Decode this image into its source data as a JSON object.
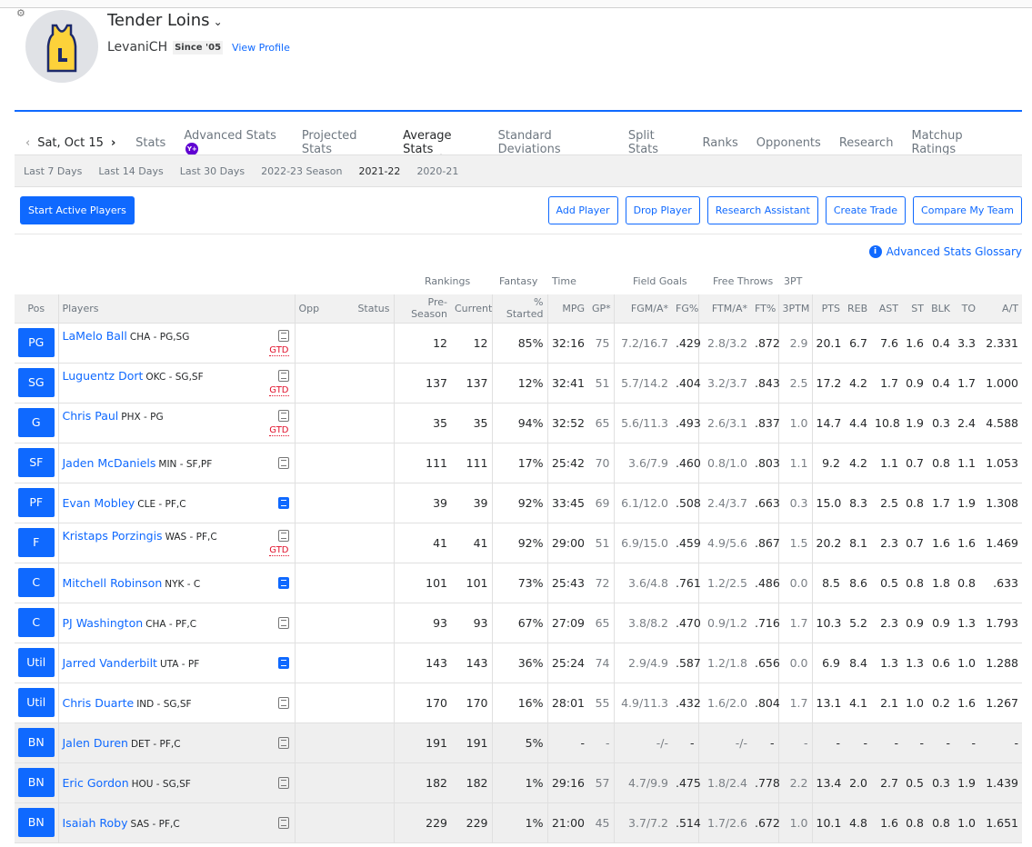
{
  "header": {
    "team_name": "Tender Loins",
    "manager": "LevaniCH",
    "since": "Since '05",
    "view_profile": "View Profile"
  },
  "nav": {
    "date": "Sat, Oct 15",
    "tabs": [
      "Stats",
      "Advanced Stats",
      "Projected Stats",
      "Average Stats",
      "Standard Deviations",
      "Split Stats",
      "Ranks",
      "Opponents",
      "Research",
      "Matchup Ratings"
    ],
    "active_tab": "Average Stats",
    "plus_badge": "Y+"
  },
  "subnav": {
    "items": [
      "Last 7 Days",
      "Last 14 Days",
      "Last 30 Days",
      "2022-23 Season",
      "2021-22",
      "2020-21"
    ],
    "active": "2021-22"
  },
  "actions": {
    "start_active": "Start Active Players",
    "add_player": "Add Player",
    "drop_player": "Drop Player",
    "research_assistant": "Research Assistant",
    "create_trade": "Create Trade",
    "compare_team": "Compare My Team"
  },
  "glossary": "Advanced Stats Glossary",
  "groups": {
    "rankings": "Rankings",
    "fantasy": "Fantasy",
    "time": "Time",
    "field_goals": "Field Goals",
    "free_throws": "Free Throws",
    "three_pt": "3PT"
  },
  "columns": [
    "Pos",
    "Players",
    "Opp",
    "Status",
    "Pre-Season",
    "Current",
    "% Started",
    "MPG",
    "GP*",
    "FGM/A*",
    "FG%",
    "FTM/A*",
    "FT%",
    "3PTM",
    "PTS",
    "REB",
    "AST",
    "ST",
    "BLK",
    "TO",
    "A/T"
  ],
  "players": [
    {
      "pos": "PG",
      "name": "LaMelo Ball",
      "team": "CHA - PG,SG",
      "status": "GTD",
      "note": "grey",
      "stats": [
        "12",
        "12",
        "85%",
        "32:16",
        "75",
        "7.2/16.7",
        ".429",
        "2.8/3.2",
        ".872",
        "2.9",
        "20.1",
        "6.7",
        "7.6",
        "1.6",
        "0.4",
        "3.3",
        "2.331"
      ]
    },
    {
      "pos": "SG",
      "name": "Luguentz Dort",
      "team": "OKC - SG,SF",
      "status": "GTD",
      "note": "grey",
      "stats": [
        "137",
        "137",
        "12%",
        "32:41",
        "51",
        "5.7/14.2",
        ".404",
        "3.2/3.7",
        ".843",
        "2.5",
        "17.2",
        "4.2",
        "1.7",
        "0.9",
        "0.4",
        "1.7",
        "1.000"
      ]
    },
    {
      "pos": "G",
      "name": "Chris Paul",
      "team": "PHX - PG",
      "status": "GTD",
      "note": "grey",
      "stats": [
        "35",
        "35",
        "94%",
        "32:52",
        "65",
        "5.6/11.3",
        ".493",
        "2.6/3.1",
        ".837",
        "1.0",
        "14.7",
        "4.4",
        "10.8",
        "1.9",
        "0.3",
        "2.4",
        "4.588"
      ]
    },
    {
      "pos": "SF",
      "name": "Jaden McDaniels",
      "team": "MIN - SF,PF",
      "status": "",
      "note": "grey",
      "stats": [
        "111",
        "111",
        "17%",
        "25:42",
        "70",
        "3.6/7.9",
        ".460",
        "0.8/1.0",
        ".803",
        "1.1",
        "9.2",
        "4.2",
        "1.1",
        "0.7",
        "0.8",
        "1.1",
        "1.053"
      ]
    },
    {
      "pos": "PF",
      "name": "Evan Mobley",
      "team": "CLE - PF,C",
      "status": "",
      "note": "blue",
      "stats": [
        "39",
        "39",
        "92%",
        "33:45",
        "69",
        "6.1/12.0",
        ".508",
        "2.4/3.7",
        ".663",
        "0.3",
        "15.0",
        "8.3",
        "2.5",
        "0.8",
        "1.7",
        "1.9",
        "1.308"
      ]
    },
    {
      "pos": "F",
      "name": "Kristaps Porzingis",
      "team": "WAS - PF,C",
      "status": "GTD",
      "note": "grey",
      "stats": [
        "41",
        "41",
        "92%",
        "29:00",
        "51",
        "6.9/15.0",
        ".459",
        "4.9/5.6",
        ".867",
        "1.5",
        "20.2",
        "8.1",
        "2.3",
        "0.7",
        "1.6",
        "1.6",
        "1.469"
      ]
    },
    {
      "pos": "C",
      "name": "Mitchell Robinson",
      "team": "NYK - C",
      "status": "",
      "note": "blue",
      "stats": [
        "101",
        "101",
        "73%",
        "25:43",
        "72",
        "3.6/4.8",
        ".761",
        "1.2/2.5",
        ".486",
        "0.0",
        "8.5",
        "8.6",
        "0.5",
        "0.8",
        "1.8",
        "0.8",
        ".633"
      ]
    },
    {
      "pos": "C",
      "name": "PJ Washington",
      "team": "CHA - PF,C",
      "status": "",
      "note": "grey",
      "stats": [
        "93",
        "93",
        "67%",
        "27:09",
        "65",
        "3.8/8.2",
        ".470",
        "0.9/1.2",
        ".716",
        "1.7",
        "10.3",
        "5.2",
        "2.3",
        "0.9",
        "0.9",
        "1.3",
        "1.793"
      ]
    },
    {
      "pos": "Util",
      "name": "Jarred Vanderbilt",
      "team": "UTA - PF",
      "status": "",
      "note": "blue",
      "stats": [
        "143",
        "143",
        "36%",
        "25:24",
        "74",
        "2.9/4.9",
        ".587",
        "1.2/1.8",
        ".656",
        "0.0",
        "6.9",
        "8.4",
        "1.3",
        "1.3",
        "0.6",
        "1.0",
        "1.288"
      ]
    },
    {
      "pos": "Util",
      "name": "Chris Duarte",
      "team": "IND - SG,SF",
      "status": "",
      "note": "grey",
      "stats": [
        "170",
        "170",
        "16%",
        "28:01",
        "55",
        "4.9/11.3",
        ".432",
        "1.6/2.0",
        ".804",
        "1.7",
        "13.1",
        "4.1",
        "2.1",
        "1.0",
        "0.2",
        "1.6",
        "1.267"
      ]
    },
    {
      "pos": "BN",
      "name": "Jalen Duren",
      "team": "DET - PF,C",
      "status": "",
      "note": "grey",
      "stats": [
        "191",
        "191",
        "5%",
        "-",
        "-",
        "-/-",
        "-",
        "-/-",
        "-",
        "-",
        "-",
        "-",
        "-",
        "-",
        "-",
        "-",
        "-"
      ]
    },
    {
      "pos": "BN",
      "name": "Eric Gordon",
      "team": "HOU - SG,SF",
      "status": "",
      "note": "grey",
      "stats": [
        "182",
        "182",
        "1%",
        "29:16",
        "57",
        "4.7/9.9",
        ".475",
        "1.8/2.4",
        ".778",
        "2.2",
        "13.4",
        "2.0",
        "2.7",
        "0.5",
        "0.3",
        "1.9",
        "1.439"
      ]
    },
    {
      "pos": "BN",
      "name": "Isaiah Roby",
      "team": "SAS - PF,C",
      "status": "",
      "note": "grey",
      "stats": [
        "229",
        "229",
        "1%",
        "21:00",
        "45",
        "3.7/7.2",
        ".514",
        "1.7/2.6",
        ".672",
        "1.0",
        "10.1",
        "4.8",
        "1.6",
        "0.8",
        "0.8",
        "1.0",
        "1.651"
      ]
    }
  ]
}
